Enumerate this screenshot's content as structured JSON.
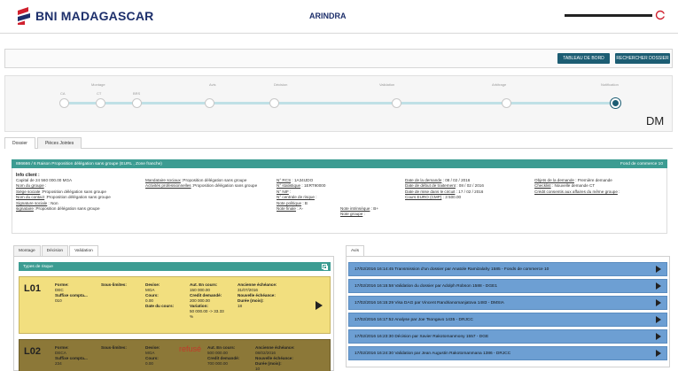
{
  "header": {
    "brand": "BNI MADAGASCAR",
    "app_title": "ARINDRA"
  },
  "colors": {
    "brand_navy": "#1d2f6b",
    "brand_red": "#d0202e",
    "teal_button": "#1c5d73",
    "teal_header": "#3c9c92",
    "risk_yellow": "#f2df7f",
    "risk_brown": "#8c7838",
    "avis_blue": "#6d9fd3"
  },
  "actions": {
    "dashboard": "TABLEAU DE BORD",
    "search_file": "RECHERCHER DOSSIER"
  },
  "workflow": {
    "stage_labels": [
      "Montage",
      "Avis",
      "Décision",
      "Validation",
      "Arbitrage",
      "Notification"
    ],
    "sub_labels": [
      "CA",
      "CT",
      "BRS"
    ],
    "current": "DM"
  },
  "tabs": [
    "Dossier",
    "Pièces Jointes"
  ],
  "detail": {
    "header_left": "886666 / 6 Raison Proposition délégation sans groupe (EURL , Zone franche)",
    "header_right": "Fond de commerce 10",
    "info_title": "Info client :",
    "col1": [
      {
        "k": "",
        "v": "Capital de 24 560 000.00 MGA"
      },
      {
        "k": "Nom du groupe",
        "v": " :"
      },
      {
        "k": "Siège sociale",
        "v": " :Proposition délégation sans groupe"
      },
      {
        "k": "Nom du contact",
        "v": " :Proposition délégation sans groupe"
      },
      {
        "k": "Signature sociale",
        "v": " : Non"
      },
      {
        "k": "signataire",
        "v": " :Proposition délégation sans groupe"
      }
    ],
    "col2": [
      {
        "k": "Mandataire sociaux",
        "v": " :Proposition délégation sans groupe"
      },
      {
        "k": "Activités professionnelles",
        "v": " :Proposition délégation sans groupe"
      }
    ],
    "col3": [
      {
        "k": "N° RCS",
        "v": " : 1A34IJDO"
      },
      {
        "k": "N° statistique",
        "v": " : 1ERT90000"
      },
      {
        "k": "N° NIF",
        "v": " :"
      },
      {
        "k": "N° centrale de risque",
        "v": " :"
      },
      {
        "k": "Note politique",
        "v": " : B"
      },
      {
        "k": "Note finale",
        "v": " : A-"
      }
    ],
    "col3b": [
      {
        "k": "Note intrinsèque",
        "v": " : B+"
      },
      {
        "k": "Note groupe",
        "v": " :"
      }
    ],
    "col4": [
      {
        "k": "Date de la demande",
        "v": " : 08 / 02 / 2016"
      },
      {
        "k": "Date de début de traitement",
        "v": " : 08 / 02 / 2016"
      },
      {
        "k": "Date de mise dans le circuit",
        "v": " : 17 / 02 / 2016"
      },
      {
        "k": "Cours EURO (CMP)",
        "v": " : 3 500.00"
      }
    ],
    "col5": [
      {
        "k": "Objets de la demande",
        "v": " : Première demande"
      },
      {
        "k": "Checklist",
        "v": " : Nouvelle demande CT"
      },
      {
        "k": "Crédit consentis aux affaires du même groupe",
        "v": " :"
      }
    ]
  },
  "left_tabs": [
    "Montage",
    "Décision",
    "Validation"
  ],
  "risk_header": "Types de risque",
  "risks": [
    {
      "code": "L01",
      "forme_label": "Forme:",
      "forme": "DEC",
      "suffixe_label": "Suffixe compta...",
      "suffixe": "010",
      "sous_limites_label": "Sous-limites:",
      "devise_label": "Devise:",
      "devise": "MGA",
      "cours_label": "Cours:",
      "cours": "0.00",
      "date_cours_label": "Date du cours:",
      "aut_label": "Aut. En cours:",
      "aut": "150 000.00",
      "credit_label": "Credit demandé:",
      "credit": "200 000.00",
      "variation_label": "Variation:",
      "variation": "50 000.00 -> 33.33",
      "variation_unit": "%",
      "echeance_label": "Ancienne échéance:",
      "echeance": "31/07/2016",
      "nouvelle_label": "Nouvelle échéance:",
      "duree_label": "Durée (mois):",
      "duree": "18"
    },
    {
      "code": "L02",
      "status": "refusé",
      "forme_label": "Forme:",
      "forme": "DECA",
      "suffixe_label": "Suffixe compta...",
      "suffixe": "234",
      "sous_limites_label": "Sous-limites:",
      "devise_label": "Devise:",
      "devise": "MGA",
      "cours_label": "Cours:",
      "cours": "0.00",
      "aut_label": "Aut. En cours:",
      "aut": "500 000.00",
      "credit_label": "Credit demandé:",
      "credit": "700 000.00",
      "echeance_label": "Ancienne échéance:",
      "echeance": "08/02/2016",
      "nouvelle_label": "Nouvelle échéance:",
      "duree_label": "Durée (mois):",
      "duree": "10"
    }
  ],
  "right_tab": "Avis",
  "avis": [
    "17/02/2016 16:14:45 Transmission d'un dossier par Anatole Ramizalahy 1585 - Fonds de commerce 10",
    "17/02/2016 16:15:58 Validation du dossier par Adolph Robson 1588 - DGE1",
    "17/02/2016 16:15:29 Visa DAG par Vincent Randrianomanjatova 1483 - DMSIA",
    "17/02/2016 16:17:52 Analyse par Joe Tsongavo 1435 - DRJCC",
    "17/02/2016 16:23:30 Décision par Xavier Rakotomanmony 1557 - DGE",
    "17/02/2016 16:24:30 Validation par Jean Augustin Rakotomanmana 1386 - DRJCC"
  ]
}
